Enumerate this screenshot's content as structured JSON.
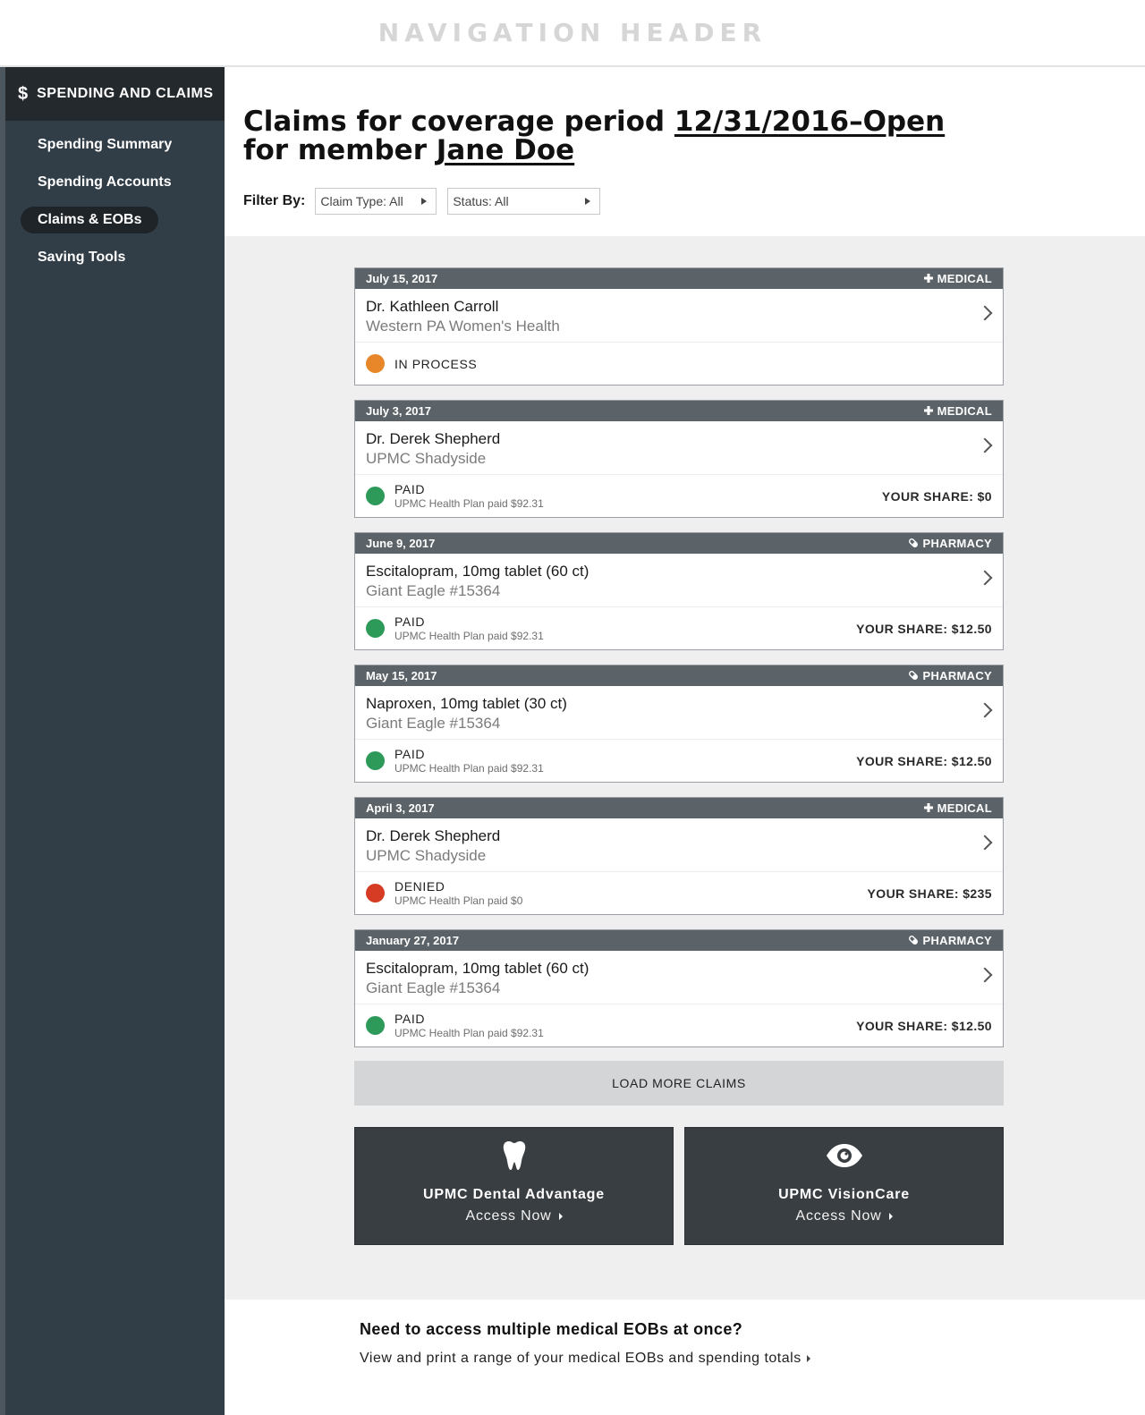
{
  "header": {
    "title": "NAVIGATION HEADER"
  },
  "sidebar": {
    "section_title": "SPENDING AND CLAIMS",
    "section_icon": "$",
    "items": [
      {
        "label": "Spending Summary",
        "active": false
      },
      {
        "label": "Spending Accounts",
        "active": false
      },
      {
        "label": "Claims & EOBs",
        "active": true
      },
      {
        "label": "Saving Tools",
        "active": false
      }
    ]
  },
  "page": {
    "title_prefix": "Claims for coverage period ",
    "period": "12/31/2016–Open",
    "title_middle": "for member ",
    "member": "Jane Doe",
    "filter_label": "Filter By:",
    "filters": [
      {
        "label": "Claim Type: All"
      },
      {
        "label": "Status: All"
      }
    ]
  },
  "colors": {
    "in_process": "#e8872a",
    "paid": "#2e9a5a",
    "denied": "#d63c24"
  },
  "claims": [
    {
      "date": "July 15, 2017",
      "type": "MEDICAL",
      "type_icon": "plus-icon",
      "name": "Dr. Kathleen Carroll",
      "provider": "Western PA Women's Health",
      "status": "IN PROCESS",
      "status_color": "in_process",
      "note": "",
      "share": ""
    },
    {
      "date": "July 3, 2017",
      "type": "MEDICAL",
      "type_icon": "plus-icon",
      "name": "Dr. Derek Shepherd",
      "provider": "UPMC Shadyside",
      "status": "PAID",
      "status_color": "paid",
      "note": "UPMC Health Plan paid $92.31",
      "share": "YOUR SHARE: $0"
    },
    {
      "date": "June 9, 2017",
      "type": "PHARMACY",
      "type_icon": "pill-icon",
      "name": "Escitalopram, 10mg tablet (60 ct)",
      "provider": "Giant Eagle #15364",
      "status": "PAID",
      "status_color": "paid",
      "note": "UPMC Health Plan paid $92.31",
      "share": "YOUR SHARE: $12.50"
    },
    {
      "date": "May 15, 2017",
      "type": "PHARMACY",
      "type_icon": "pill-icon",
      "name": "Naproxen, 10mg tablet (30 ct)",
      "provider": "Giant Eagle #15364",
      "status": "PAID",
      "status_color": "paid",
      "note": "UPMC Health Plan paid $92.31",
      "share": "YOUR SHARE: $12.50"
    },
    {
      "date": "April 3, 2017",
      "type": "MEDICAL",
      "type_icon": "plus-icon",
      "name": "Dr. Derek Shepherd",
      "provider": "UPMC Shadyside",
      "status": "DENIED",
      "status_color": "denied",
      "note": "UPMC Health Plan paid $0",
      "share": "YOUR SHARE: $235"
    },
    {
      "date": "January 27, 2017",
      "type": "PHARMACY",
      "type_icon": "pill-icon",
      "name": "Escitalopram, 10mg tablet (60 ct)",
      "provider": "Giant Eagle #15364",
      "status": "PAID",
      "status_color": "paid",
      "note": "UPMC Health Plan paid $92.31",
      "share": "YOUR SHARE: $12.50"
    }
  ],
  "load_more": "LOAD MORE CLAIMS",
  "promos": [
    {
      "icon": "tooth-icon",
      "title": "UPMC Dental Advantage",
      "link": "Access Now"
    },
    {
      "icon": "eye-icon",
      "title": "UPMC VisionCare",
      "link": "Access Now"
    }
  ],
  "bottom": {
    "title": "Need to access multiple medical EOBs at once?",
    "link": "View and print a range of your medical EOBs and spending totals"
  }
}
